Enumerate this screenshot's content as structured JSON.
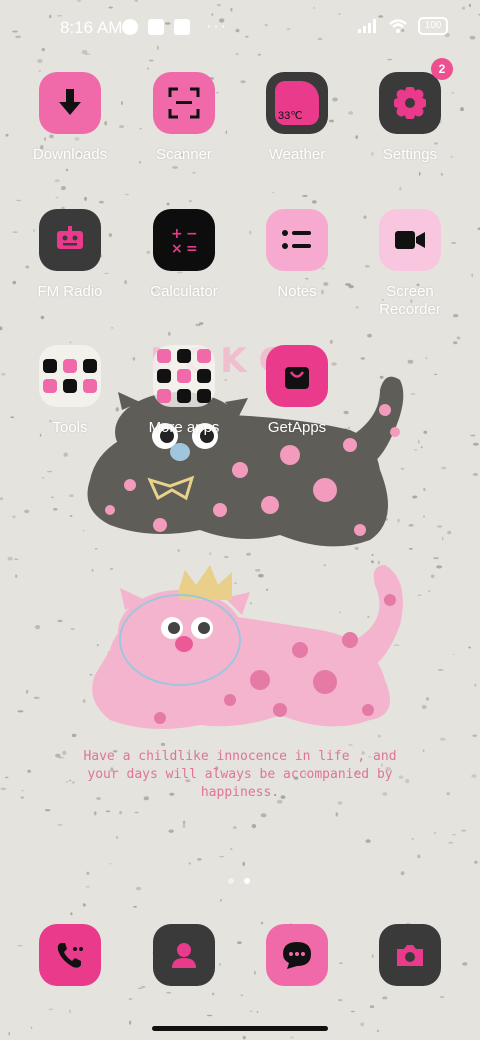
{
  "status_bar": {
    "time": "8:16 AM",
    "battery": "100",
    "more": "···"
  },
  "apps": [
    {
      "label": "Downloads",
      "icon": "download-icon",
      "badge": null
    },
    {
      "label": "Scanner",
      "icon": "scanner-icon",
      "badge": null
    },
    {
      "label": "Weather",
      "icon": "weather-icon",
      "badge": null,
      "temp": "33℃"
    },
    {
      "label": "Settings",
      "icon": "gear-icon",
      "badge": "2"
    },
    {
      "label": "FM Radio",
      "icon": "radio-icon",
      "badge": null
    },
    {
      "label": "Calculator",
      "icon": "calculator-icon",
      "badge": null
    },
    {
      "label": "Notes",
      "icon": "notes-icon",
      "badge": null
    },
    {
      "label": "Screen\nRecorder",
      "icon": "video-camera-icon",
      "badge": null
    },
    {
      "label": "Tools",
      "icon": "folder-icon",
      "badge": null
    },
    {
      "label": "More apps",
      "icon": "folder-icon",
      "badge": null
    },
    {
      "label": "GetApps",
      "icon": "shopping-bag-icon",
      "badge": null
    }
  ],
  "wallpaper": {
    "tagline": "Have a childlike innocence in life , and your days will always be accompanied by happiness."
  },
  "dock": [
    {
      "name": "phone",
      "icon": "phone-icon"
    },
    {
      "name": "contacts",
      "icon": "contact-icon"
    },
    {
      "name": "messages",
      "icon": "message-icon"
    },
    {
      "name": "camera",
      "icon": "camera-icon"
    }
  ],
  "page_indicator": {
    "pages": 2,
    "current": 2
  },
  "colors": {
    "background": "#e4e3dd",
    "pink": "#f06aa9",
    "hot_pink": "#ea3a8c",
    "dark": "#3a3a3a",
    "cat_gray": "#5f5d57",
    "cat_pink": "#f4b4cd"
  }
}
